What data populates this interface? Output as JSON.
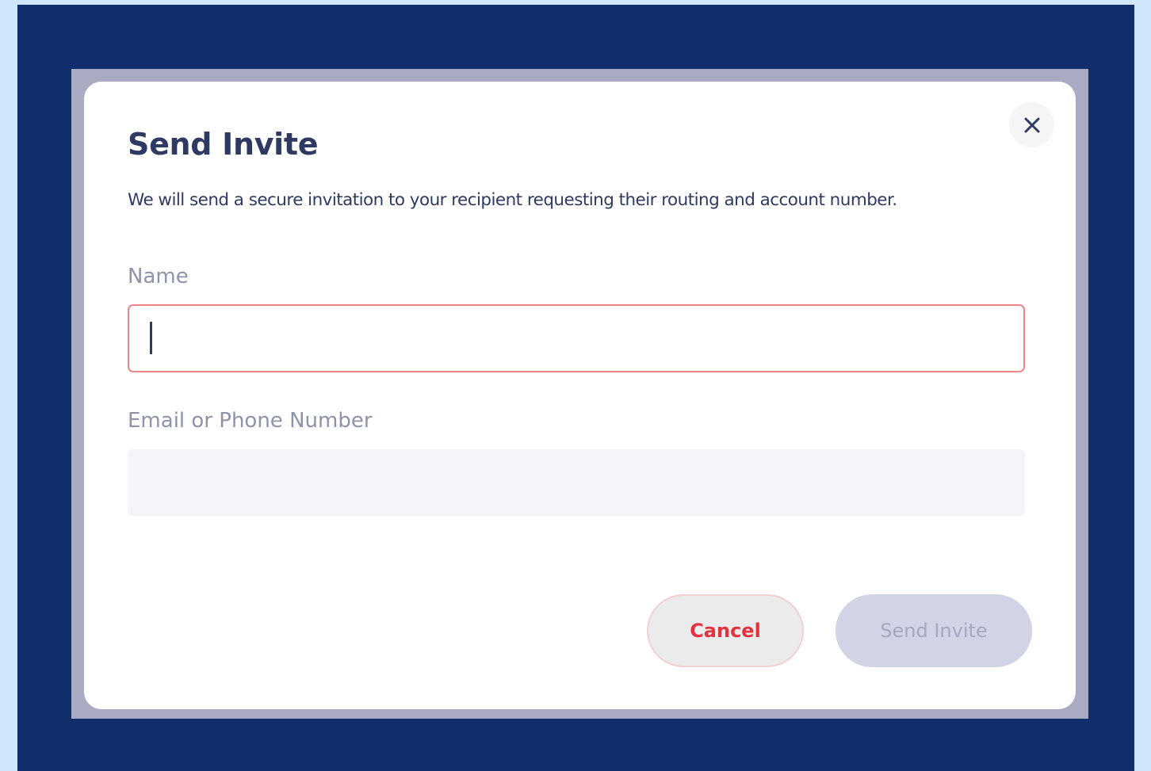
{
  "modal": {
    "title": "Send Invite",
    "description": "We will send a secure invitation to your recipient requesting their routing and account number.",
    "close_icon": "close-icon"
  },
  "form": {
    "name_label": "Name",
    "name_value": "",
    "contact_label": "Email or Phone Number",
    "contact_value": ""
  },
  "actions": {
    "cancel_label": "Cancel",
    "send_label": "Send Invite"
  },
  "colors": {
    "backdrop": "#112e6c",
    "outer_background": "#cfe6fb",
    "heading_text": "#2f3a63",
    "error_border": "#f08589",
    "cancel_text": "#e4323f",
    "disabled_button": "#d0d4e4"
  }
}
